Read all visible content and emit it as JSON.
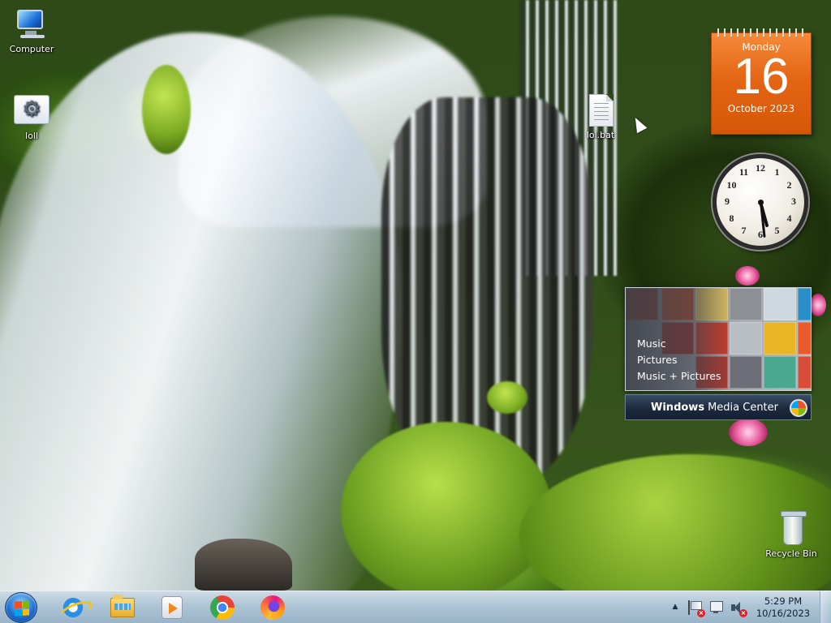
{
  "desktop": {
    "icons": [
      {
        "label": "Computer",
        "icon": "computer-icon"
      },
      {
        "label": "loll",
        "icon": "settings-file-icon"
      },
      {
        "label": "lol.bat",
        "icon": "batch-file-icon"
      },
      {
        "label": "Recycle Bin",
        "icon": "recycle-bin-icon"
      }
    ]
  },
  "gadgets": {
    "calendar": {
      "weekday": "Monday",
      "day": "16",
      "month_year": "October 2023",
      "color": "#e46614"
    },
    "clock": {
      "hour": 5,
      "minute": 29,
      "numerals": [
        "12",
        "1",
        "2",
        "3",
        "4",
        "5",
        "6",
        "7",
        "8",
        "9",
        "10",
        "11"
      ]
    },
    "media_center": {
      "menu": [
        "Music",
        "Pictures",
        "Music + Pictures"
      ],
      "brand_bold": "Windows",
      "brand_rest": "Media Center"
    }
  },
  "taskbar": {
    "start": {
      "icon": "windows-logo-icon"
    },
    "pinned": [
      {
        "icon": "internet-explorer-icon"
      },
      {
        "icon": "file-explorer-icon"
      },
      {
        "icon": "windows-media-player-icon"
      },
      {
        "icon": "chrome-icon"
      },
      {
        "icon": "firefox-icon"
      }
    ],
    "tray": {
      "arrow": "▲",
      "badge": "×",
      "time": "5:29 PM",
      "date": "10/16/2023"
    }
  }
}
